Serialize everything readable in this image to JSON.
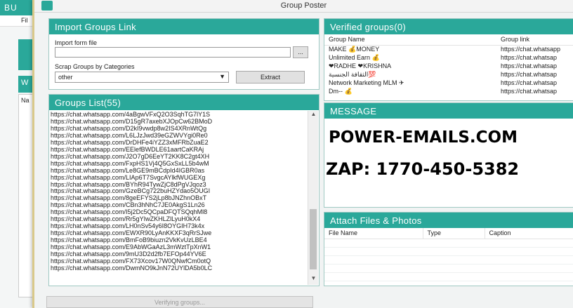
{
  "background_window": {
    "title": "BU",
    "menu_file": "Fil",
    "tab_label": "W",
    "list_header": "Na"
  },
  "window": {
    "title": "Group Poster"
  },
  "import_panel": {
    "title": "Import Groups Link",
    "import_label": "Import form file",
    "file_path_value": "",
    "browse_label": "...",
    "scrap_label": "Scrap Groups by Categories",
    "category_selected": "other",
    "extract_label": "Extract"
  },
  "groups_list": {
    "title": "Groups List(55)",
    "links": [
      "https://chat.whatsapp.com/4aBgwVFxQ2O3SqhTG7lY1S",
      "https://chat.whatsapp.com/D15gR7axebXJOpCw62BMoD",
      "https://chat.whatsapp.com/D2kI9vwdp8w2IS4XRnWtQg",
      "https://chat.whatsapp.com/L6LJzJwd39eGZWVYgi0Re0",
      "https://chat.whatsapp.com/DrDHFe4iYZZ3xMFRbZuaE2",
      "https://chat.whatsapp.com/EElefBWDLE61aartCaKRAj",
      "https://chat.whatsapp.com/J2O7gD6EeYT2KK8C2gt4XH",
      "https://chat.whatsapp.com/FxpHS1Vj4Q5GxSxLL5b4wM",
      "https://chat.whatsapp.com/Le8GE9mBCdpId4IGBR0as",
      "https://chat.whatsapp.com/LIAp6T7SvgcAYlkfWUGEXg",
      "https://chat.whatsapp.com/BYhR94TywZjC8dPgVJqoz3",
      "https://chat.whatsapp.com/GzeBCg722buHZYdao5OUGI",
      "https://chat.whatsapp.com/8geEFYS2jLp8bJNZhnOBxT",
      "https://chat.whatsapp.com/CBn3hNhC7JE0AkgS1Ln26",
      "https://chat.whatsapp.com/I5j2Dc5QCpaDFQTSQqhMl8",
      "https://chat.whatsapp.com/Rr5gYIwZKHLZlLyuH0kX4",
      "https://chat.whatsapp.com/LH0nSv54y6I8OYGIH73k4x",
      "https://chat.whatsapp.com/EWXR90LyAnKKXF3qRrSJwe",
      "https://chat.whatsapp.com/BmFoB9biuzn2VkKvUzLBE4",
      "https://chat.whatsapp.com/E9AbWGaAzL3mWztTpXnW1",
      "https://chat.whatsapp.com/9mU3D2d2fb7EFOp44YV6E",
      "https://chat.whatsapp.com/FX73Xcov17W0QNwfCm0otQ",
      "https://chat.whatsapp.com/DwmNO9kJnN72UYlDA5b0LC"
    ],
    "verify_label": "Verifying groups..."
  },
  "verified_panel": {
    "title": "Verified groups(0)",
    "col_name": "Group Name",
    "col_link": "Group link",
    "rows": [
      {
        "name": "MAKE 💰MONEY",
        "link": "https://chat.whatsapp"
      },
      {
        "name": "Unlimited Earn 💰",
        "link": "https://chat.whatsap"
      },
      {
        "name": "❤RADHE ❤KRISHNA",
        "link": "https://chat.whatsap"
      },
      {
        "name": "الثقافة الجنسية💯",
        "link": "https://chat.whatsap"
      },
      {
        "name": "Network Marketing MLM ✈",
        "link": "https://chat.whatsap"
      },
      {
        "name": "Dm-- 💰",
        "link": "https://chat.whatsap"
      }
    ]
  },
  "message_panel": {
    "title": "MESSAGE",
    "line1": "POWER-EMAILS.COM",
    "line2": "ZAP: 1770-450-5382"
  },
  "attach_panel": {
    "title": "Attach Files & Photos",
    "col_file": "File Name",
    "col_type": "Type",
    "col_caption": "Caption"
  }
}
